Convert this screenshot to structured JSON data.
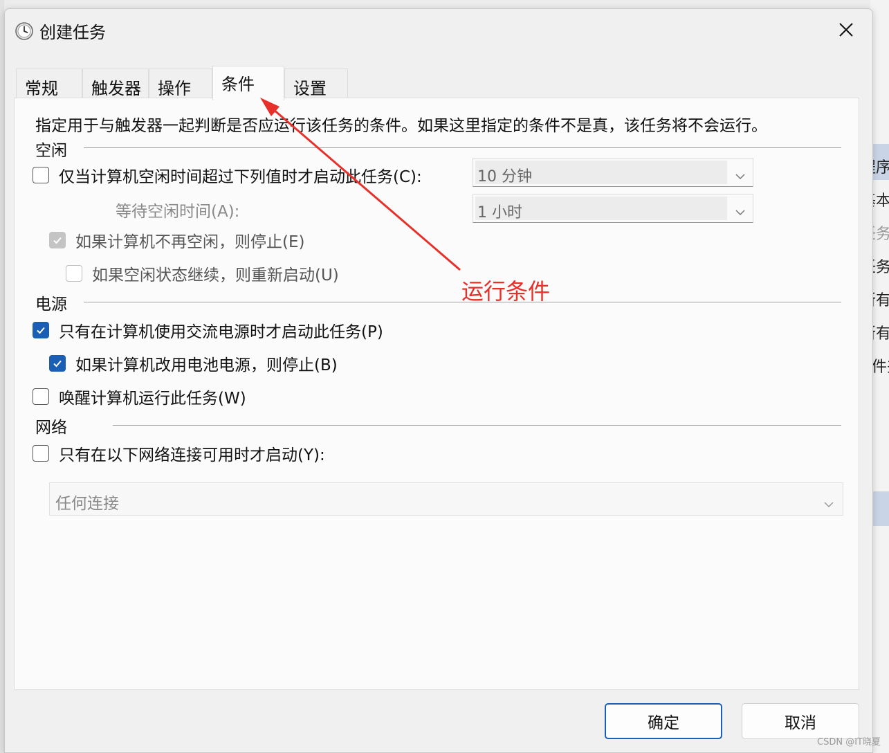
{
  "dialog": {
    "title": "创建任务",
    "close_label": "✕",
    "icon": "clock-icon"
  },
  "tabs": [
    {
      "label": "常规",
      "active": false
    },
    {
      "label": "触发器",
      "active": false
    },
    {
      "label": "操作",
      "active": false
    },
    {
      "label": "条件",
      "active": true
    },
    {
      "label": "设置",
      "active": false
    }
  ],
  "conditions": {
    "description": "指定用于与触发器一起判断是否应运行该任务的条件。如果这里指定的条件不是真，该任务将不会运行。",
    "idle": {
      "group_label": "空闲",
      "start_if_idle": {
        "label": "仅当计算机空闲时间超过下列值时才启动此任务(C):",
        "checked": false
      },
      "idle_duration": "10 分钟",
      "wait_label": "等待空闲时间(A):",
      "wait_duration": "1 小时",
      "stop_if_not_idle": {
        "label": "如果计算机不再空闲，则停止(E)",
        "checked": true,
        "disabled": true
      },
      "restart_if_idle": {
        "label": "如果空闲状态继续，则重新启动(U)",
        "checked": false,
        "disabled": true
      }
    },
    "power": {
      "group_label": "电源",
      "ac_only": {
        "label": "只有在计算机使用交流电源时才启动此任务(P)",
        "checked": true
      },
      "stop_on_battery": {
        "label": "如果计算机改用电池电源，则停止(B)",
        "checked": true
      },
      "wake_to_run": {
        "label": "唤醒计算机运行此任务(W)",
        "checked": false
      }
    },
    "network": {
      "group_label": "网络",
      "only_if_network": {
        "label": "只有在以下网络连接可用时才启动(Y):",
        "checked": false
      },
      "connection": "任何连接"
    }
  },
  "buttons": {
    "ok": "确定",
    "cancel": "取消"
  },
  "annotation": {
    "text": "运行条件",
    "color": "#e8302a"
  },
  "background_app": {
    "fragments": [
      "程序",
      "基本",
      "任务",
      "任务",
      "所有",
      "所有",
      "文件夹"
    ]
  },
  "watermark": "CSDN @IT晓夏",
  "colors": {
    "accent": "#1a5fb4",
    "annotation": "#e8302a"
  }
}
